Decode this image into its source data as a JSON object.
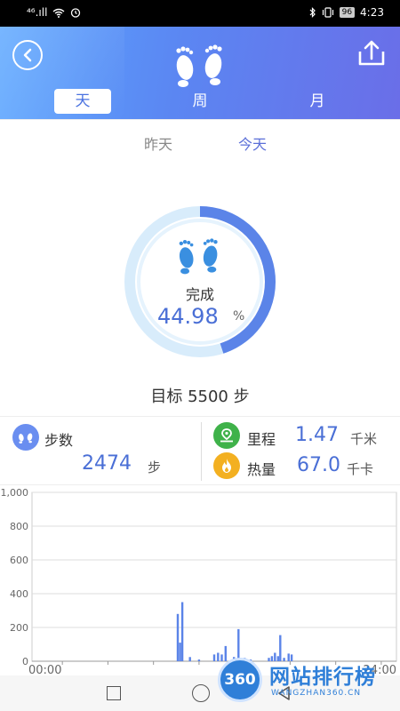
{
  "status_bar": {
    "signal": "⁴⁶.ıll",
    "battery": "96",
    "time": "4:23"
  },
  "header": {
    "tabs": [
      {
        "label": "天",
        "active": true
      },
      {
        "label": "周",
        "active": false
      },
      {
        "label": "月",
        "active": false
      }
    ]
  },
  "subtabs": {
    "yesterday": "昨天",
    "today": "今天"
  },
  "progress": {
    "label": "完成",
    "percent_text": "44.98",
    "percent_sign": "%",
    "fraction": 0.4498
  },
  "goal": {
    "text": "目标 5500 步"
  },
  "stats": {
    "steps": {
      "label": "步数",
      "value": "2474",
      "unit": "步"
    },
    "distance": {
      "label": "里程",
      "value": "1.47",
      "unit": "千米"
    },
    "calories": {
      "label": "热量",
      "value": "67.0",
      "unit": "千卡"
    }
  },
  "colors": {
    "accent": "#4a6fd6",
    "bar": "#5b84e8",
    "ring_track": "#d8ecfb",
    "ring_progress": "#5b84e8"
  },
  "chart_data": {
    "type": "bar",
    "y_ticks": [
      "0",
      "200",
      "400",
      "600",
      "800",
      "1,000"
    ],
    "ylim": [
      0,
      1000
    ],
    "x_tick_labels": [
      "00:00",
      "24:00"
    ],
    "xlim": [
      0,
      24
    ],
    "bars": [
      {
        "hour": 9.6,
        "value": 280
      },
      {
        "hour": 9.75,
        "value": 110
      },
      {
        "hour": 9.9,
        "value": 350
      },
      {
        "hour": 10.4,
        "value": 25
      },
      {
        "hour": 11.0,
        "value": 10
      },
      {
        "hour": 12.0,
        "value": 40
      },
      {
        "hour": 12.25,
        "value": 50
      },
      {
        "hour": 12.5,
        "value": 40
      },
      {
        "hour": 12.75,
        "value": 90
      },
      {
        "hour": 13.3,
        "value": 25
      },
      {
        "hour": 13.6,
        "value": 190
      },
      {
        "hour": 14.0,
        "value": 20
      },
      {
        "hour": 14.4,
        "value": 10
      },
      {
        "hour": 15.6,
        "value": 20
      },
      {
        "hour": 15.8,
        "value": 30
      },
      {
        "hour": 16.0,
        "value": 50
      },
      {
        "hour": 16.2,
        "value": 30
      },
      {
        "hour": 16.35,
        "value": 155
      },
      {
        "hour": 16.6,
        "value": 20
      },
      {
        "hour": 16.9,
        "value": 45
      },
      {
        "hour": 17.1,
        "value": 40
      }
    ]
  },
  "watermark": {
    "logo": "360",
    "name": "网站排行榜",
    "url": "WANGZHAN360.CN"
  }
}
